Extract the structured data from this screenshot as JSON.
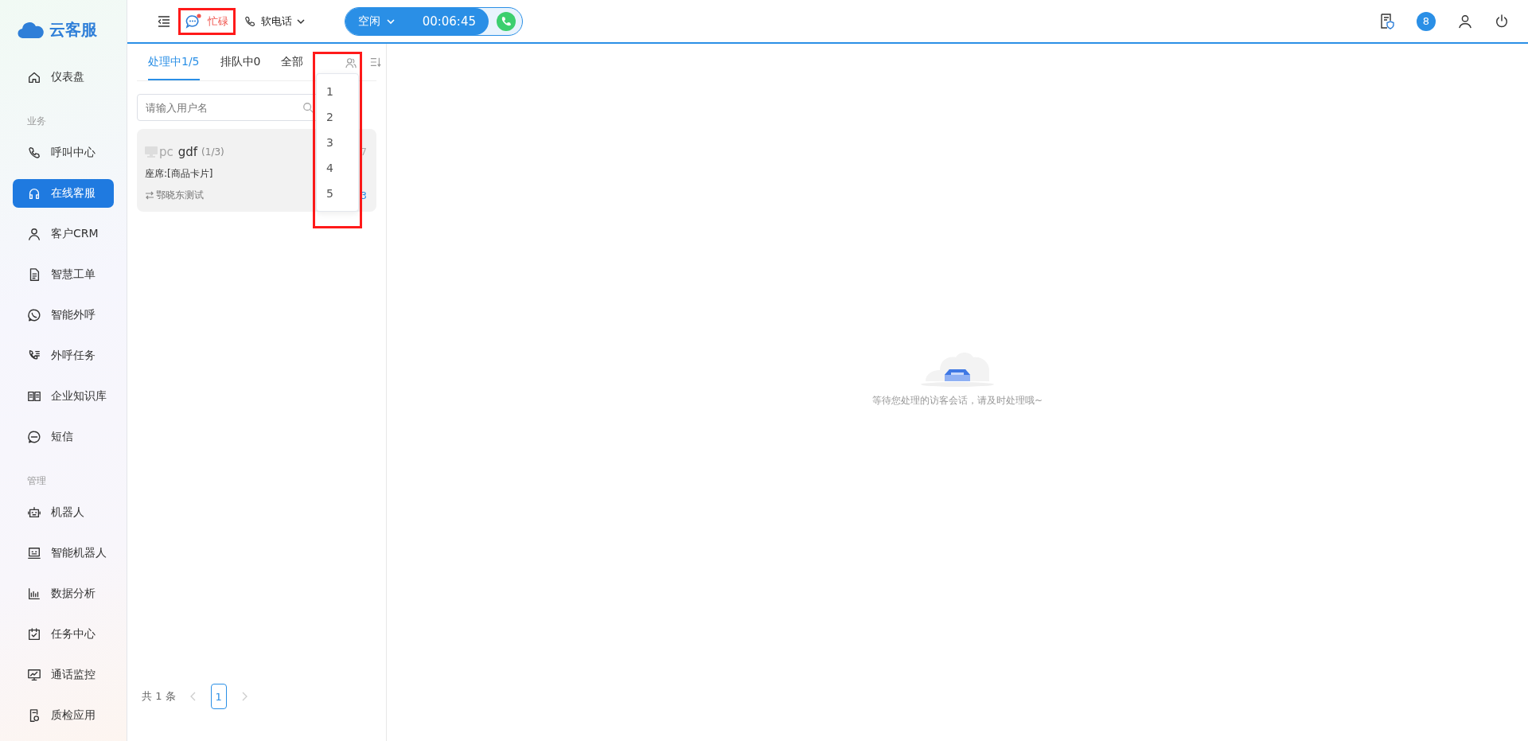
{
  "logo": {
    "text": "云客服"
  },
  "sidebar": {
    "sections": [
      {
        "items": [
          {
            "label": "仪表盘",
            "selected": false
          }
        ]
      },
      {
        "heading": "业务",
        "items": [
          {
            "label": "呼叫中心",
            "selected": false
          },
          {
            "label": "在线客服",
            "selected": true
          },
          {
            "label": "客户CRM",
            "selected": false
          },
          {
            "label": "智慧工单",
            "selected": false
          },
          {
            "label": "智能外呼",
            "selected": false
          },
          {
            "label": "外呼任务",
            "selected": false
          },
          {
            "label": "企业知识库",
            "selected": false
          },
          {
            "label": "短信",
            "selected": false
          }
        ]
      },
      {
        "heading": "管理",
        "items": [
          {
            "label": "机器人",
            "selected": false
          },
          {
            "label": "智能机器人",
            "selected": false
          },
          {
            "label": "数据分析",
            "selected": false
          },
          {
            "label": "任务中心",
            "selected": false
          },
          {
            "label": "通话监控",
            "selected": false
          },
          {
            "label": "质检应用",
            "selected": false
          }
        ]
      }
    ]
  },
  "header": {
    "status": {
      "label": "忙碌",
      "highlighted": true
    },
    "softphone": {
      "label": "软电话"
    },
    "call": {
      "state": "空闲",
      "timer": "00:06:45"
    },
    "notification_badge": "8"
  },
  "tabs": [
    {
      "label": "处理中1/5",
      "selected": true
    },
    {
      "label": "排队中0",
      "selected": false
    },
    {
      "label": "全部",
      "selected": false
    }
  ],
  "search": {
    "placeholder": "请输入用户名"
  },
  "sessions": [
    {
      "device": "pc",
      "name": "gdf",
      "count": "(1/3)",
      "seat": "座席:[商品卡片]",
      "agent": "鄂晓东测试",
      "time_fragment": "7",
      "tag_fragment": "3"
    }
  ],
  "dropdown": {
    "highlighted": true,
    "options": [
      "1",
      "2",
      "3",
      "4",
      "5"
    ]
  },
  "pagination": {
    "total": "共 1 条",
    "pages": [
      {
        "label": "1",
        "selected": true
      }
    ]
  },
  "empty_state": {
    "message": "等待您处理的访客会话，请及时处理哦~"
  }
}
